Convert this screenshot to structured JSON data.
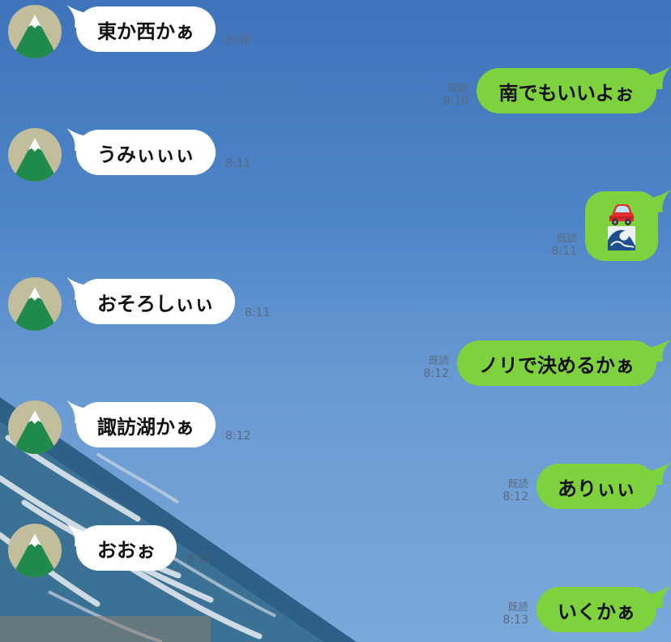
{
  "messages": [
    {
      "text": "東か西かぁ",
      "time": "8:09"
    },
    {
      "text": "南でもいいよぉ",
      "read": "既読",
      "time": "8:10"
    },
    {
      "text": "うみぃぃぃ",
      "time": "8:11"
    },
    {
      "icons": [
        "car-icon",
        "wave-icon"
      ],
      "read": "既読",
      "time": "8:11"
    },
    {
      "text": "おそろしぃぃ",
      "time": "8:11"
    },
    {
      "text": "ノリで決めるかぁ",
      "read": "既読",
      "time": "8:12"
    },
    {
      "text": "諏訪湖かぁ",
      "time": "8:12"
    },
    {
      "text": "ありぃぃ",
      "read": "既読",
      "time": "8:12"
    },
    {
      "text": "おおぉ",
      "time": "8:12"
    },
    {
      "text": "いくかぁ",
      "read": "既読",
      "time": "8:13"
    }
  ],
  "colors": {
    "outgoing_bubble": "#7ed23e",
    "incoming_bubble": "#ffffff",
    "avatar_bg": "#c2bd9a",
    "avatar_mountain": "#1f8a4c"
  }
}
